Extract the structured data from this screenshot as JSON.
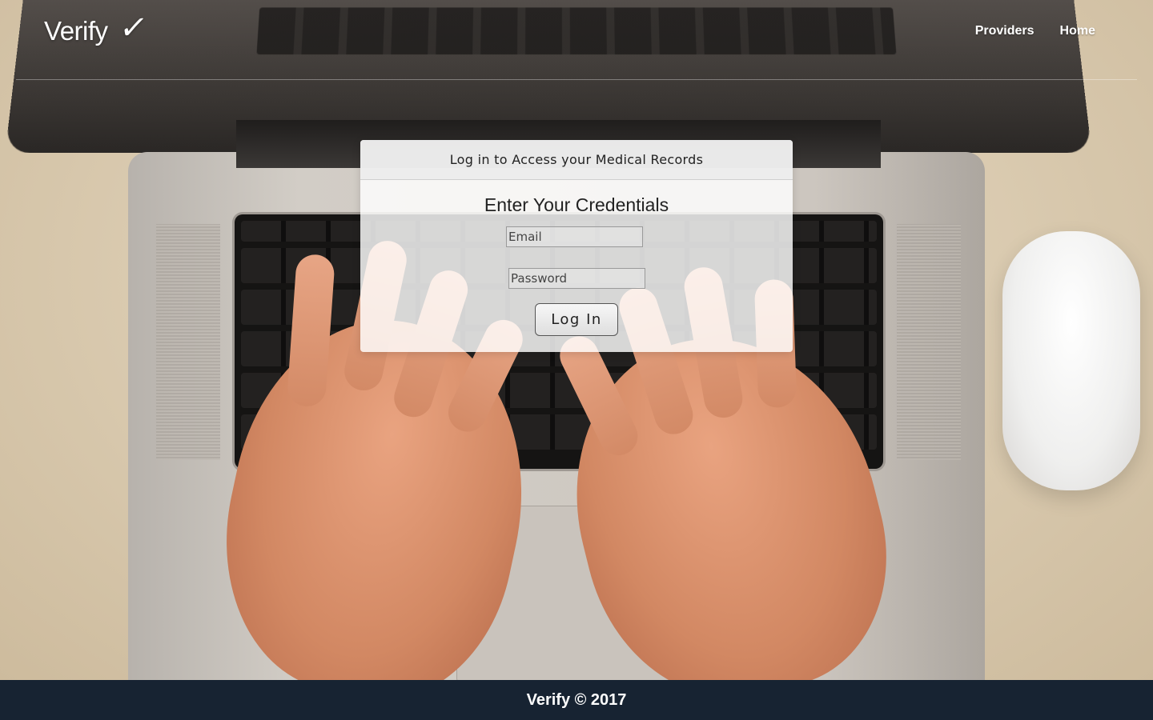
{
  "nav": {
    "brand": "Verify",
    "brand_check": "✓",
    "links": [
      "Providers",
      "Home"
    ]
  },
  "login": {
    "header": "Log in to Access your Medical Records",
    "title": "Enter Your Credentials",
    "email_placeholder": "Email",
    "password_placeholder": "Password",
    "button_label": "Log In"
  },
  "footer": {
    "text": "Verify © 2017"
  },
  "colors": {
    "footer_bg": "#172332",
    "card_bg": "rgba(255,255,255,0.82)"
  }
}
